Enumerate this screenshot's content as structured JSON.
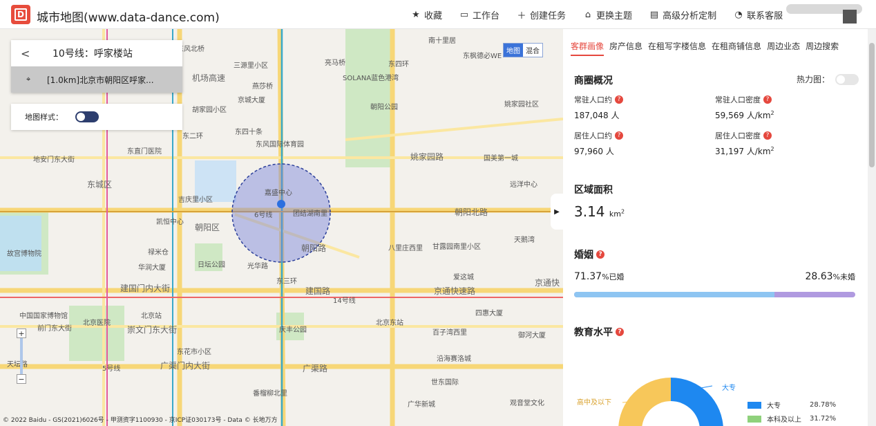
{
  "app": {
    "logo_letter": "D",
    "title": "城市地图(www.data-dance.com)"
  },
  "nav": [
    {
      "label": "收藏",
      "icon": "star-icon"
    },
    {
      "label": "工作台",
      "icon": "monitor-icon"
    },
    {
      "label": "创建任务",
      "icon": "plus-icon"
    },
    {
      "label": "更换主题",
      "icon": "shirt-icon"
    },
    {
      "label": "高级分析定制",
      "icon": "document-icon"
    },
    {
      "label": "联系客服",
      "icon": "headset-icon"
    }
  ],
  "route": {
    "back": "<",
    "title": "10号线：呼家楼站",
    "subtitle": "[1.0km]北京市朝阳区呼家..."
  },
  "map_style": {
    "label": "地图样式："
  },
  "map_type": {
    "map": "地图",
    "hybrid": "混合"
  },
  "zoom": {
    "in": "+",
    "out": "−"
  },
  "copyright": "© 2022 Baidu - GS(2021)6026号 - 甲测资字1100930 - 京ICP证030173号 - Data © 长地万方",
  "map_labels": [
    "三源里小区",
    "燕莎桥",
    "京城大厦",
    "东风北桥",
    "南十里居",
    "亮马桥",
    "SOLANA蓝色港湾",
    "朝阳公园",
    "东枫德必WE",
    "姚家园社区",
    "东风国际体育园",
    "胡家园小区",
    "机场高速",
    "姚家园路",
    "国美第一城",
    "远洋中心",
    "东直门医院",
    "东四十条",
    "吉庆里小区",
    "嘉盛中心",
    "团结湖南里",
    "朝阳区",
    "凯恒中心",
    "朝阳北路",
    "八里庄西里",
    "甘露园南里小区",
    "天鹅湾",
    "朝阳路",
    "禄米仓",
    "华润大厦",
    "日坛公园",
    "光华路",
    "建国门内大街",
    "建国路",
    "京通快速路",
    "爱这城",
    "四惠大厦",
    "北京站",
    "北京东站",
    "北京医院",
    "庆丰公园",
    "崇文门东大街",
    "东花市小区",
    "百子湾西里",
    "沿海赛洛城",
    "广渠门内大街",
    "广渠路",
    "世东国际",
    "番榴柳北里",
    "广华新城",
    "东城区",
    "故宫博物院",
    "中国国家博物馆",
    "前门东大街",
    "天坛路",
    "地安门东大街",
    "东二环",
    "东三环",
    "东四环",
    "御河大厦",
    "观音堂文化",
    "京通快",
    "6号线",
    "14号线",
    "5号线"
  ],
  "panel": {
    "tabs": [
      "客群画像",
      "房产信息",
      "在租写字楼信息",
      "在租商铺信息",
      "周边业态",
      "周边搜索"
    ],
    "overview": {
      "title": "商圈概况",
      "heatmap_label": "热力图：",
      "resident_pop_label": "常驻人口约",
      "resident_pop_value": "187,048",
      "resident_pop_unit": "人",
      "resident_density_label": "常驻人口密度",
      "resident_density_value": "59,569",
      "density_unit": "人/km",
      "living_pop_label": "居住人口约",
      "living_pop_value": "97,960",
      "living_pop_unit": "人",
      "living_density_label": "居住人口密度",
      "living_density_value": "31,197"
    },
    "area": {
      "title": "区域面积",
      "value": "3.14",
      "unit": "km"
    },
    "marriage": {
      "title": "婚姻",
      "married_pct": "71.37",
      "married_label": "%已婚",
      "unmarried_pct": "28.63",
      "unmarried_label": "%未婚",
      "married_fraction": 0.7137
    },
    "education": {
      "title": "教育水平",
      "donut_labels": {
        "a": "大专",
        "b": "高中及以下"
      },
      "legend": [
        {
          "name": "大专",
          "pct": "28.78%",
          "color": "#1e88f0"
        },
        {
          "name": "本科及以上",
          "pct": "31.72%",
          "color": "#8fd17c"
        }
      ]
    }
  },
  "colors": {
    "accent": "#e5483e",
    "toggle": "#2d3e6e",
    "map_select": "#3b73d9"
  }
}
